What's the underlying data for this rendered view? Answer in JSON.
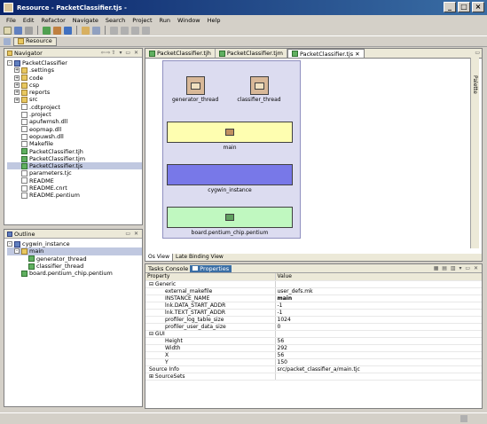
{
  "window": {
    "title": "Resource - PacketClassifier.tjs -",
    "min": "_",
    "max": "□",
    "close": "×"
  },
  "menu": [
    "File",
    "Edit",
    "Refactor",
    "Navigate",
    "Search",
    "Project",
    "Run",
    "Window",
    "Help"
  ],
  "perspective": {
    "label": "Resource"
  },
  "navigator": {
    "title": "Navigator",
    "items": [
      {
        "label": "PacketClassifier",
        "icon": "proj",
        "indent": 0,
        "exp": "-"
      },
      {
        "label": ".settings",
        "icon": "folder",
        "indent": 1,
        "exp": "+"
      },
      {
        "label": "code",
        "icon": "folder",
        "indent": 1,
        "exp": "+"
      },
      {
        "label": "csp",
        "icon": "folder",
        "indent": 1,
        "exp": "+"
      },
      {
        "label": "reports",
        "icon": "folder",
        "indent": 1,
        "exp": "+"
      },
      {
        "label": "src",
        "icon": "folder",
        "indent": 1,
        "exp": "+"
      },
      {
        "label": ".cdtproject",
        "icon": "file",
        "indent": 1
      },
      {
        "label": ".project",
        "icon": "file",
        "indent": 1
      },
      {
        "label": "apufwmsh.dll",
        "icon": "file",
        "indent": 1
      },
      {
        "label": "eopmap.dll",
        "icon": "file",
        "indent": 1
      },
      {
        "label": "eopuwsh.dll",
        "icon": "file",
        "indent": 1
      },
      {
        "label": "Makefile",
        "icon": "file",
        "indent": 1
      },
      {
        "label": "PacketClassifier.tjh",
        "icon": "green",
        "indent": 1
      },
      {
        "label": "PacketClassifier.tjm",
        "icon": "green",
        "indent": 1
      },
      {
        "label": "PacketClassifier.tjs",
        "icon": "green",
        "indent": 1,
        "selected": true
      },
      {
        "label": "parameters.tjc",
        "icon": "file",
        "indent": 1
      },
      {
        "label": "README",
        "icon": "file",
        "indent": 1
      },
      {
        "label": "README.cnrt",
        "icon": "file",
        "indent": 1
      },
      {
        "label": "README.pentium",
        "icon": "file",
        "indent": 1
      }
    ]
  },
  "outline": {
    "title": "Outline",
    "items": [
      {
        "label": "cygwin_instance",
        "icon": "proj",
        "indent": 0,
        "exp": "-"
      },
      {
        "label": "main",
        "icon": "folder",
        "indent": 1,
        "exp": "-",
        "selected": true
      },
      {
        "label": "generator_thread",
        "icon": "green",
        "indent": 2
      },
      {
        "label": "classifier_thread",
        "icon": "green",
        "indent": 2
      },
      {
        "label": "board.pentium_chip.pentium",
        "icon": "green",
        "indent": 1
      }
    ]
  },
  "editor": {
    "tabs": [
      "PacketClassifier.tjh",
      "PacketClassifier.tjm",
      "PacketClassifier.tjs"
    ],
    "active_tab": 2,
    "palette_label": "Palette",
    "components": {
      "generator": "generator_thread",
      "classifier": "classifier_thread",
      "main": "main",
      "cygwin": "cygwin_instance",
      "board": "board.pentium_chip.pentium"
    },
    "colors": {
      "canvas": "#dcdcf0",
      "main": "#fefeb0",
      "cygwin": "#7878e8",
      "board": "#c0f8c0",
      "thread": "#d8b898"
    },
    "bottom_tabs": [
      "Os View",
      "Late Binding View"
    ]
  },
  "properties": {
    "tabs": [
      "Tasks",
      "Console",
      "Properties"
    ],
    "col_property": "Property",
    "col_value": "Value",
    "rows": [
      {
        "p": "⊟ Generic",
        "v": "",
        "group": true
      },
      {
        "p": "external_makefile",
        "v": "user_defs.mk"
      },
      {
        "p": "INSTANCE_NAME",
        "v": "main",
        "bold": true
      },
      {
        "p": "lnk.DATA_START_ADDR",
        "v": "-1"
      },
      {
        "p": "lnk.TEXT_START_ADDR",
        "v": "-1"
      },
      {
        "p": "profiler_log_table_size",
        "v": "1024"
      },
      {
        "p": "profiler_user_data_size",
        "v": "0"
      },
      {
        "p": "⊟ GUI",
        "v": "",
        "group": true
      },
      {
        "p": "Height",
        "v": "56"
      },
      {
        "p": "Width",
        "v": "292"
      },
      {
        "p": "X",
        "v": "56"
      },
      {
        "p": "Y",
        "v": "150"
      },
      {
        "p": "Source Info",
        "v": "src/packet_classifier_a/main.tjc",
        "top": true
      },
      {
        "p": "⊞ SourceSets",
        "v": "",
        "group": true
      }
    ]
  }
}
